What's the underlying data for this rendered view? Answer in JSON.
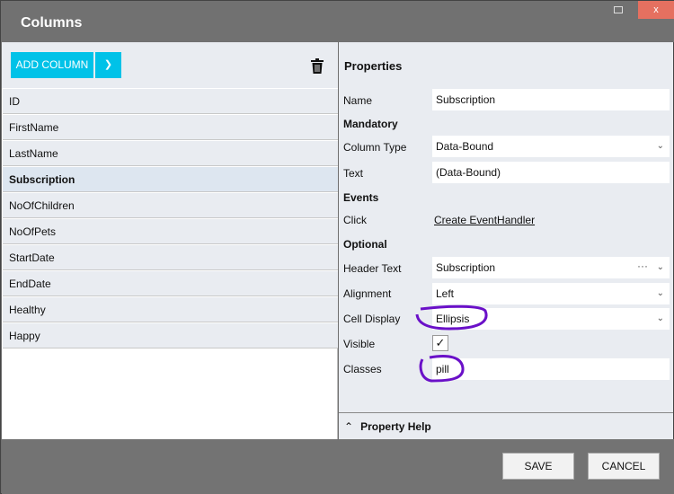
{
  "window": {
    "title": "Columns",
    "close": "x"
  },
  "toolbar": {
    "add_column": "ADD COLUMN"
  },
  "columns": [
    "ID",
    "FirstName",
    "LastName",
    "Subscription",
    "NoOfChildren",
    "NoOfPets",
    "StartDate",
    "EndDate",
    "Healthy",
    "Happy"
  ],
  "selected_column": "Subscription",
  "properties": {
    "title": "Properties",
    "name_label": "Name",
    "name_value": "Subscription",
    "mandatory": "Mandatory",
    "column_type_label": "Column Type",
    "column_type_value": "Data-Bound",
    "text_label": "Text",
    "text_value": "(Data-Bound)",
    "events": "Events",
    "click_label": "Click",
    "click_link": "Create EventHandler",
    "optional": "Optional",
    "header_text_label": "Header Text",
    "header_text_value": "Subscription",
    "alignment_label": "Alignment",
    "alignment_value": "Left",
    "cell_display_label": "Cell Display",
    "cell_display_value": "Ellipsis",
    "visible_label": "Visible",
    "visible_checked": true,
    "classes_label": "Classes",
    "classes_value": "pill",
    "help": "Property Help"
  },
  "footer": {
    "save": "SAVE",
    "cancel": "CANCEL"
  },
  "colors": {
    "accent": "#00c2e8",
    "annotation": "#6a10c8"
  }
}
